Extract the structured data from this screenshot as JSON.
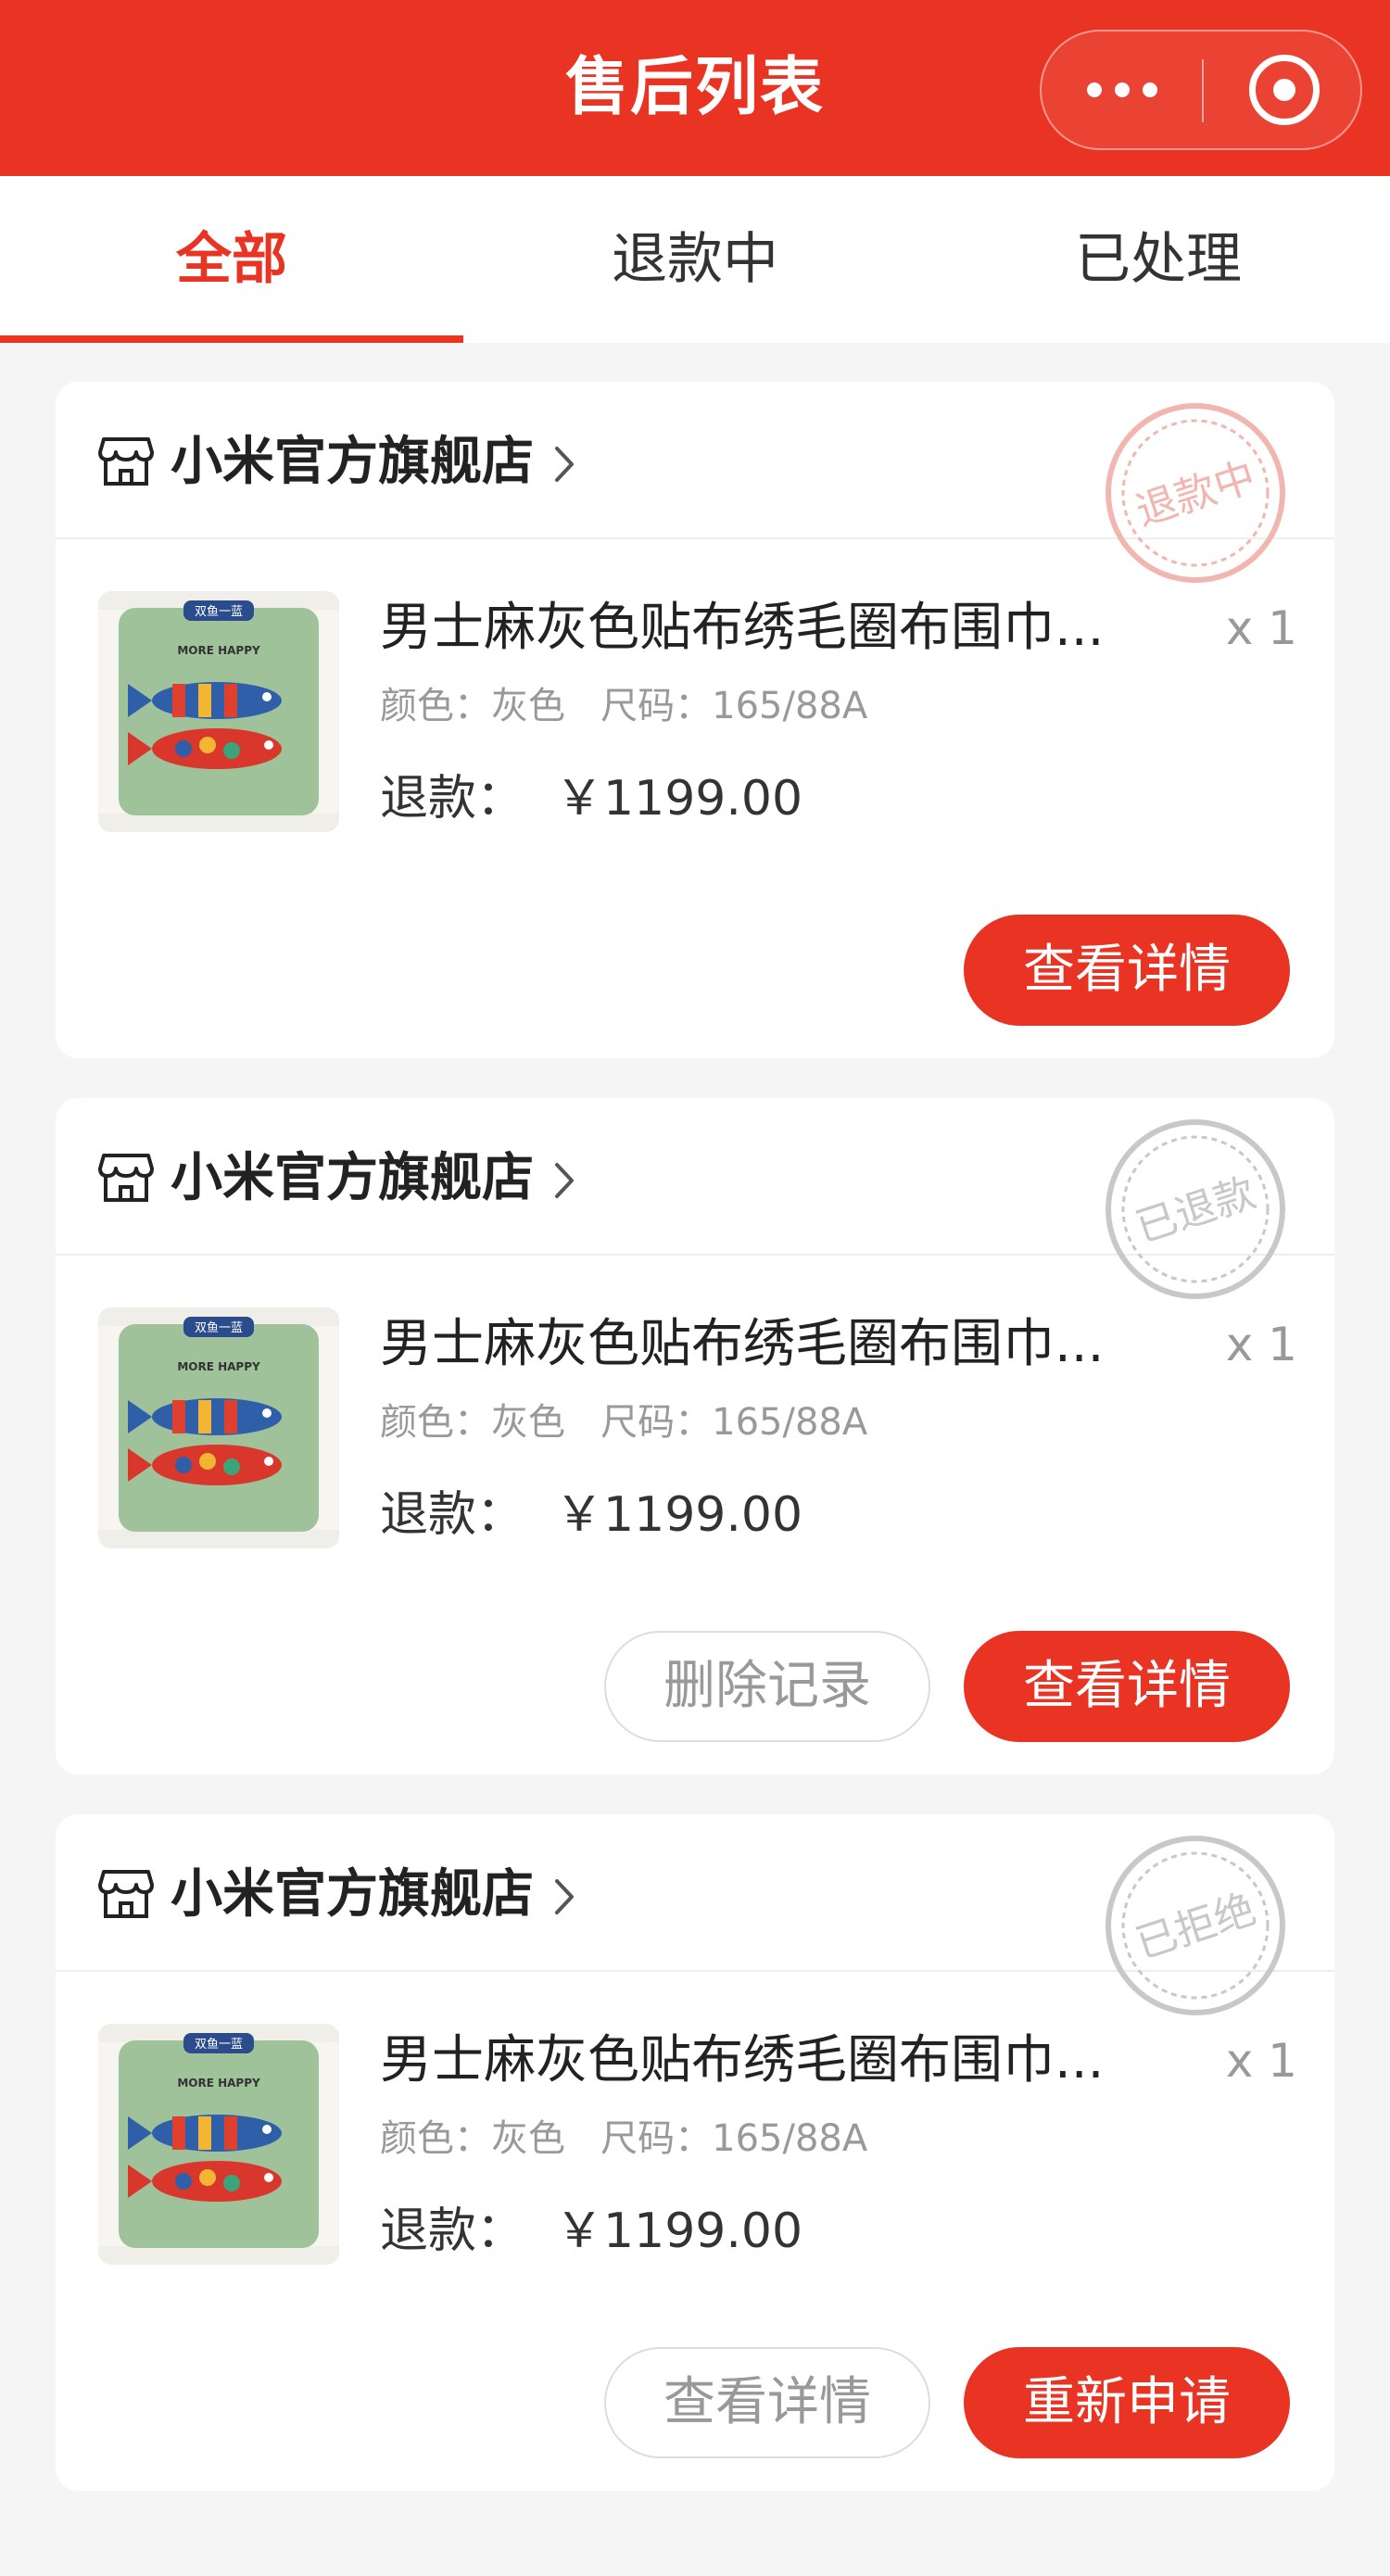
{
  "header": {
    "title": "售后列表",
    "bg_color": "#e93323"
  },
  "capsule": {
    "more_icon": "more-dots-icon",
    "close_icon": "target-circle-icon"
  },
  "tabs": [
    {
      "label": "全部",
      "active": true
    },
    {
      "label": "退款中",
      "active": false
    },
    {
      "label": "已处理",
      "active": false
    }
  ],
  "theme": {
    "accent": "#e93323",
    "muted_text": "#999999",
    "stamp_refunding": "#f2b6b1",
    "stamp_gray": "#c8c8c8"
  },
  "orders": [
    {
      "store_name": "小米官方旗舰店",
      "store_icon": "store-icon",
      "status_stamp": "退款中",
      "product_name": "男士麻灰色贴布绣毛圈布围巾...",
      "quantity": "x 1",
      "spec": "颜色：灰色   尺码：165/88A",
      "refund": "退款：  ￥1199.00",
      "buttons": [
        {
          "label": "查看详情",
          "style": "primary"
        }
      ]
    },
    {
      "store_name": "小米官方旗舰店",
      "store_icon": "store-icon",
      "status_stamp": "已退款",
      "product_name": "男士麻灰色贴布绣毛圈布围巾...",
      "quantity": "x 1",
      "spec": "颜色：灰色   尺码：165/88A",
      "refund": "退款：  ￥1199.00",
      "buttons": [
        {
          "label": "删除记录",
          "style": "ghost"
        },
        {
          "label": "查看详情",
          "style": "primary"
        }
      ]
    },
    {
      "store_name": "小米官方旗舰店",
      "store_icon": "store-icon",
      "status_stamp": "已拒绝",
      "product_name": "男士麻灰色贴布绣毛圈布围巾...",
      "quantity": "x 1",
      "spec": "颜色：灰色   尺码：165/88A",
      "refund": "退款：  ￥1199.00",
      "buttons": [
        {
          "label": "查看详情",
          "style": "ghost"
        },
        {
          "label": "重新申请",
          "style": "primary"
        }
      ]
    }
  ],
  "product_image": {
    "badge": "双鱼一蓝",
    "caption": "MORE HAPPY",
    "icon": "fish-pillow-image"
  }
}
